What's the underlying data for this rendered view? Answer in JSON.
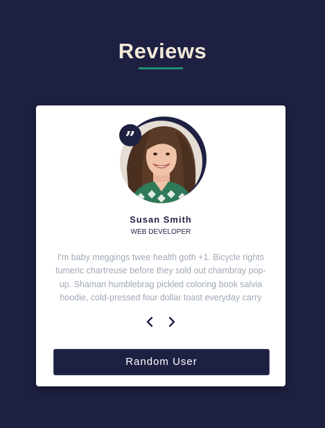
{
  "page": {
    "title": "Reviews"
  },
  "review": {
    "quote_icon": "quote-icon",
    "name": "Susan Smith",
    "job": "web developer",
    "text": "I'm baby meggings twee health goth +1. Bicycle rights tumeric chartreuse before they sold out chambray pop-up. Shaman humblebrag pickled coloring book salvia hoodie, cold-pressed four dollar toast everyday carry",
    "prev_icon": "chevron-left-icon",
    "next_icon": "chevron-right-icon"
  },
  "actions": {
    "random_label": "Random User"
  },
  "colors": {
    "background": "#1e2042",
    "accent": "#1f8f6f",
    "title": "#f2ead7",
    "card": "#ffffff",
    "text_muted": "#9fa8b4"
  }
}
